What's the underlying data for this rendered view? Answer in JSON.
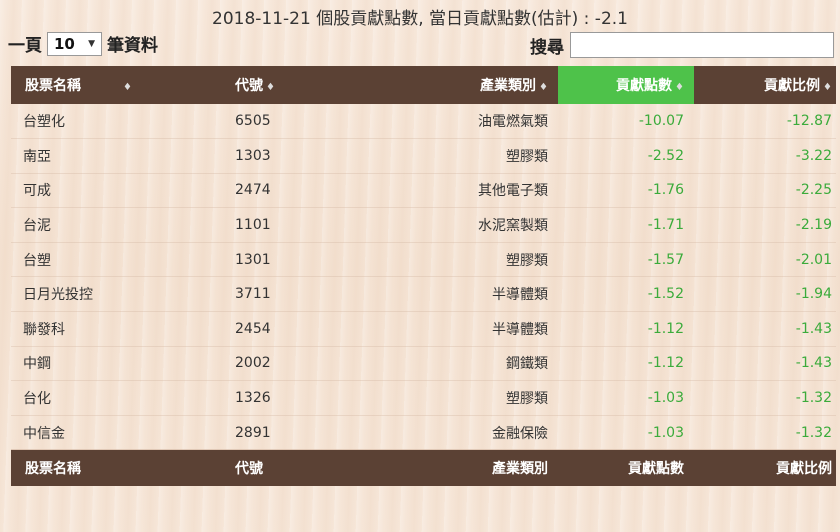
{
  "header": {
    "title": "2018-11-21 個股貢獻點數, 當日貢獻點數(估計) : -2.1"
  },
  "length_control": {
    "prefix": "一頁",
    "selected": "10",
    "suffix": "筆資料",
    "caret_icon": "▼"
  },
  "search": {
    "label": "搜尋",
    "value": "",
    "placeholder": ""
  },
  "colors": {
    "header_bg": "#5b4134",
    "sorted_header_bg": "#4ec24a",
    "negative_value": "#3bab3b"
  },
  "columns": [
    {
      "label": "股票名稱",
      "sort_icon": "♦"
    },
    {
      "label": "代號",
      "sort_icon": "♦"
    },
    {
      "label": "產業類別",
      "sort_icon": "♦"
    },
    {
      "label": "貢獻點數",
      "sort_icon": "♦"
    },
    {
      "label": "貢獻比例",
      "sort_icon": "♦"
    }
  ],
  "rows": [
    {
      "name": "台塑化",
      "code": "6505",
      "industry": "油電燃氣類",
      "points": "-10.07",
      "ratio": "-12.87"
    },
    {
      "name": "南亞",
      "code": "1303",
      "industry": "塑膠類",
      "points": "-2.52",
      "ratio": "-3.22"
    },
    {
      "name": "可成",
      "code": "2474",
      "industry": "其他電子類",
      "points": "-1.76",
      "ratio": "-2.25"
    },
    {
      "name": "台泥",
      "code": "1101",
      "industry": "水泥窯製類",
      "points": "-1.71",
      "ratio": "-2.19"
    },
    {
      "name": "台塑",
      "code": "1301",
      "industry": "塑膠類",
      "points": "-1.57",
      "ratio": "-2.01"
    },
    {
      "name": "日月光投控",
      "code": "3711",
      "industry": "半導體類",
      "points": "-1.52",
      "ratio": "-1.94"
    },
    {
      "name": "聯發科",
      "code": "2454",
      "industry": "半導體類",
      "points": "-1.12",
      "ratio": "-1.43"
    },
    {
      "name": "中鋼",
      "code": "2002",
      "industry": "鋼鐵類",
      "points": "-1.12",
      "ratio": "-1.43"
    },
    {
      "name": "台化",
      "code": "1326",
      "industry": "塑膠類",
      "points": "-1.03",
      "ratio": "-1.32"
    },
    {
      "name": "中信金",
      "code": "2891",
      "industry": "金融保險",
      "points": "-1.03",
      "ratio": "-1.32"
    }
  ],
  "footer": [
    "股票名稱",
    "代號",
    "產業類別",
    "貢獻點數",
    "貢獻比例"
  ]
}
